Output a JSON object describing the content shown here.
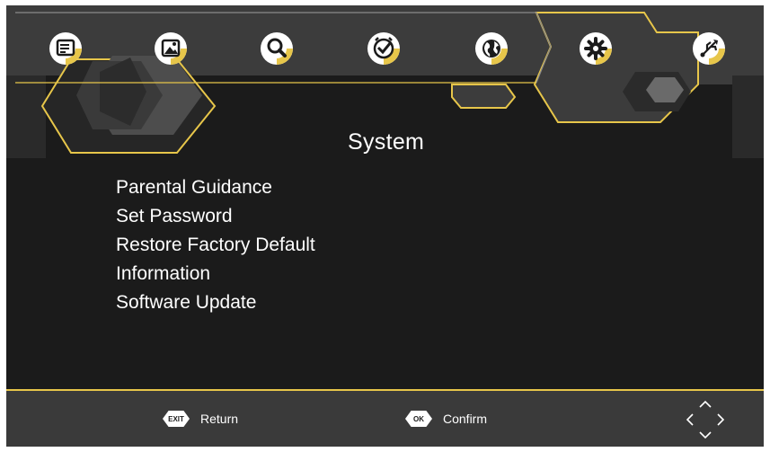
{
  "top_menu": {
    "items": [
      {
        "name": "program-guide",
        "icon": "tv-guide-icon"
      },
      {
        "name": "picture",
        "icon": "picture-icon"
      },
      {
        "name": "search",
        "icon": "search-icon"
      },
      {
        "name": "time",
        "icon": "clock-icon"
      },
      {
        "name": "language",
        "icon": "globe-icon"
      },
      {
        "name": "system",
        "icon": "gear-icon",
        "selected": true
      },
      {
        "name": "usb",
        "icon": "usb-icon"
      }
    ]
  },
  "section": {
    "title": "System"
  },
  "menu": {
    "items": [
      {
        "label": "Parental Guidance"
      },
      {
        "label": "Set Password"
      },
      {
        "label": "Restore Factory Default"
      },
      {
        "label": "Information"
      },
      {
        "label": "Software Update"
      }
    ]
  },
  "footer": {
    "exit_key": "EXIT",
    "return_label": "Return",
    "ok_key": "OK",
    "confirm_label": "Confirm"
  },
  "colors": {
    "accent": "#e7c64a",
    "background": "#1b1b1b",
    "panel": "#3a3a3a",
    "text": "#ffffff"
  }
}
